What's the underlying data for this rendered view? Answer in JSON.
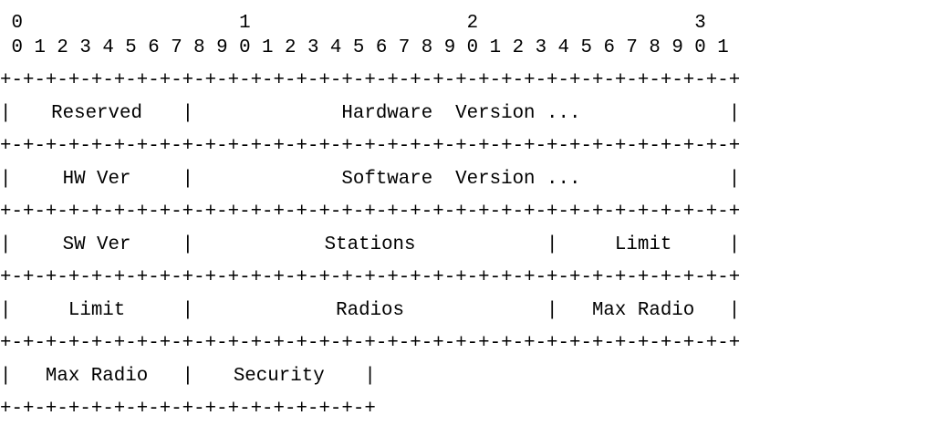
{
  "diagram": {
    "tens_ruler": " 0                   1                   2                   3",
    "ones_ruler": " 0 1 2 3 4 5 6 7 8 9 0 1 2 3 4 5 6 7 8 9 0 1 2 3 4 5 6 7 8 9 0 1",
    "border_full": "+-+-+-+-+-+-+-+-+-+-+-+-+-+-+-+-+-+-+-+-+-+-+-+-+-+-+-+-+-+-+-+-+",
    "border_partial": "+-+-+-+-+-+-+-+-+-+-+-+-+-+-+-+-+",
    "separator": "|",
    "rows": [
      {
        "fields": [
          {
            "label": "Reserved",
            "bits": 8
          },
          {
            "label": "Hardware  Version ...",
            "bits": 24
          }
        ]
      },
      {
        "fields": [
          {
            "label": "HW Ver",
            "bits": 8
          },
          {
            "label": "Software  Version ...",
            "bits": 24
          }
        ]
      },
      {
        "fields": [
          {
            "label": "SW Ver",
            "bits": 8
          },
          {
            "label": "Stations",
            "bits": 16
          },
          {
            "label": "Limit",
            "bits": 8
          }
        ]
      },
      {
        "fields": [
          {
            "label": "Limit",
            "bits": 8
          },
          {
            "label": "Radios",
            "bits": 16
          },
          {
            "label": "Max Radio",
            "bits": 8
          }
        ]
      },
      {
        "fields": [
          {
            "label": "Max Radio",
            "bits": 8
          },
          {
            "label": "Security",
            "bits": 8
          }
        ]
      }
    ]
  }
}
